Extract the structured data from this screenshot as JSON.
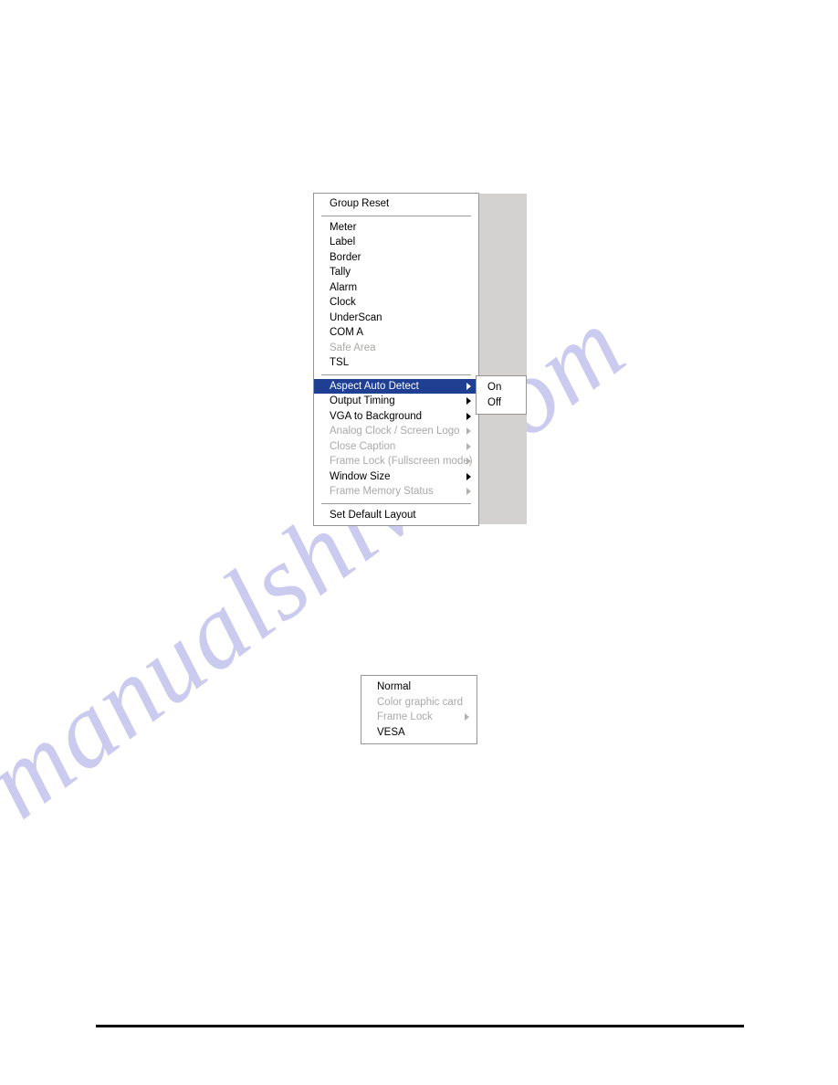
{
  "watermark": {
    "text": "manualshive.com"
  },
  "menus": {
    "main": {
      "name": "layout-context-menu",
      "header": {
        "label": "Group Reset"
      },
      "items": [
        {
          "label": "Meter",
          "disabled": false,
          "submenu": false,
          "selected": false
        },
        {
          "label": "Label",
          "disabled": false,
          "submenu": false,
          "selected": false
        },
        {
          "label": "Border",
          "disabled": false,
          "submenu": false,
          "selected": false
        },
        {
          "label": "Tally",
          "disabled": false,
          "submenu": false,
          "selected": false
        },
        {
          "label": "Alarm",
          "disabled": false,
          "submenu": false,
          "selected": false
        },
        {
          "label": "Clock",
          "disabled": false,
          "submenu": false,
          "selected": false
        },
        {
          "label": "UnderScan",
          "disabled": false,
          "submenu": false,
          "selected": false
        },
        {
          "label": "COM A",
          "disabled": false,
          "submenu": false,
          "selected": false
        },
        {
          "label": "Safe Area",
          "disabled": true,
          "submenu": false,
          "selected": false
        },
        {
          "label": "TSL",
          "disabled": false,
          "submenu": false,
          "selected": false
        },
        {
          "separator": true
        },
        {
          "label": "Aspect Auto Detect",
          "disabled": false,
          "submenu": true,
          "selected": true
        },
        {
          "label": "Output Timing",
          "disabled": false,
          "submenu": true,
          "selected": false
        },
        {
          "label": "VGA to Background",
          "disabled": false,
          "submenu": true,
          "selected": false
        },
        {
          "label": "Analog Clock / Screen Logo",
          "disabled": true,
          "submenu": true,
          "selected": false
        },
        {
          "label": "Close Caption",
          "disabled": true,
          "submenu": true,
          "selected": false
        },
        {
          "label": "Frame Lock (Fullscreen mode)",
          "disabled": true,
          "submenu": true,
          "selected": false
        },
        {
          "label": "Window Size",
          "disabled": false,
          "submenu": true,
          "selected": false
        },
        {
          "label": "Frame Memory Status",
          "disabled": true,
          "submenu": true,
          "selected": false
        },
        {
          "separator": true
        },
        {
          "label": "Set Default Layout",
          "disabled": false,
          "submenu": false,
          "selected": false
        }
      ]
    },
    "aspect_submenu": {
      "name": "aspect-auto-detect-submenu",
      "items": [
        {
          "label": "On",
          "disabled": false,
          "submenu": false,
          "selected": false
        },
        {
          "label": "Off",
          "disabled": false,
          "submenu": false,
          "selected": false
        }
      ]
    },
    "output_timing_menu": {
      "name": "output-timing-submenu",
      "items": [
        {
          "label": "Normal",
          "disabled": false,
          "submenu": false,
          "selected": false
        },
        {
          "label": "Color graphic card",
          "disabled": true,
          "submenu": false,
          "selected": false
        },
        {
          "label": "Frame Lock",
          "disabled": true,
          "submenu": true,
          "selected": false
        },
        {
          "label": "VESA",
          "disabled": false,
          "submenu": false,
          "selected": false
        }
      ]
    }
  },
  "colors": {
    "menu_background": "#ffffff",
    "menu_border": "#969593",
    "highlight": "#1f3f93",
    "highlight_text": "#ffffff",
    "disabled_text": "#aaa9a7",
    "shadow_panel": "#d4d2d0",
    "watermark": "#c9c8ef",
    "rule": "#000000"
  }
}
